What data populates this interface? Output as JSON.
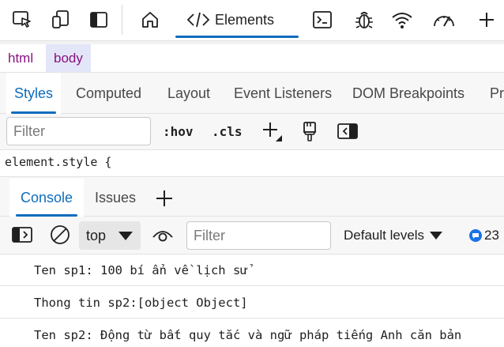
{
  "toolbar": {
    "icons": [
      "inspect-icon",
      "device-emulation-icon",
      "dock-side-icon",
      "welcome-home-icon",
      "console-tab-icon",
      "sources-bug-icon",
      "network-wifi-icon",
      "performance-gauge-icon",
      "more-tools-plus-icon"
    ],
    "elements_label": "Elements"
  },
  "breadcrumb": {
    "html": "html",
    "body": "body"
  },
  "styles_tabs": [
    "Styles",
    "Computed",
    "Layout",
    "Event Listeners",
    "DOM Breakpoints",
    "Pr"
  ],
  "styles_filter": {
    "placeholder": "Filter",
    "hov": ":hov",
    "cls": ".cls"
  },
  "element_style": "element.style {",
  "drawer_tabs": {
    "console": "Console",
    "issues": "Issues"
  },
  "console_toolbar": {
    "context": "top",
    "filter_placeholder": "Filter",
    "levels": "Default levels",
    "message_count": "23"
  },
  "messages": [
    "Ten sp1: 100 bí ẩn về lịch sử",
    "Thong tin sp2:[object Object]",
    "Ten sp2: Động từ bất quy tắc và ngữ pháp tiếng Anh căn bản"
  ],
  "colors": {
    "accent": "#0f6cbd",
    "tag": "#881280",
    "selected_crumb": "#e3e6f8"
  }
}
